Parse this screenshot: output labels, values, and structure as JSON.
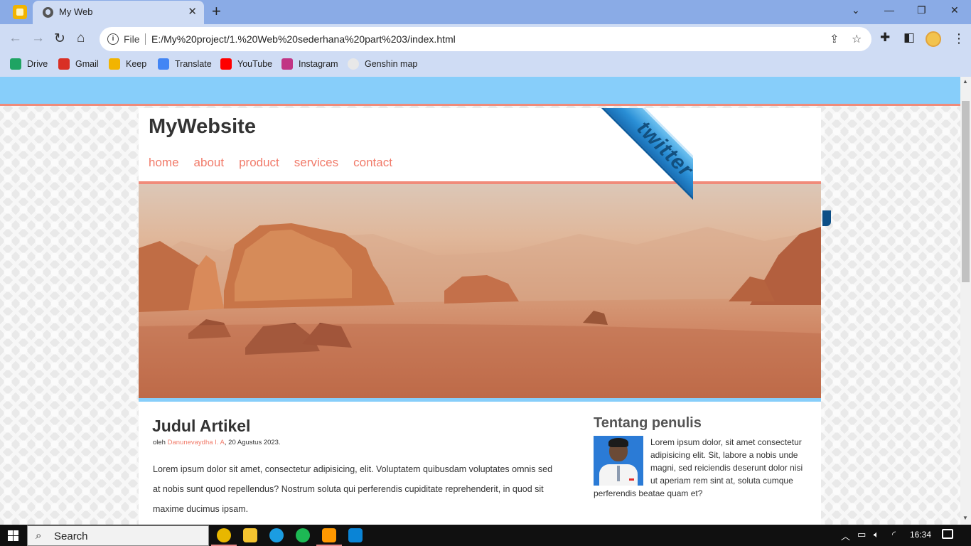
{
  "browser": {
    "tab_title": "My Web",
    "tab_close": "✕",
    "new_tab": "+",
    "window_controls": {
      "dropdown": "⌄",
      "minimize": "—",
      "restore": "❐",
      "close": "✕"
    },
    "file_label": "File",
    "url": "E:/My%20project/1.%20Web%20sederhana%20part%203/index.html",
    "bookmarks": [
      {
        "label": "Drive",
        "color": "#1fa463"
      },
      {
        "label": "Gmail",
        "color": "#d93025"
      },
      {
        "label": "Keep",
        "color": "#f2b400"
      },
      {
        "label": "Translate",
        "color": "#4285f4"
      },
      {
        "label": "YouTube",
        "color": "#ff0000"
      },
      {
        "label": "Instagram",
        "color": "#c13584"
      },
      {
        "label": "Genshin map",
        "color": "#e8e8e8"
      }
    ]
  },
  "site": {
    "title": "MyWebsite",
    "menu": [
      "home",
      "about",
      "product",
      "services",
      "contact"
    ],
    "ribbon_text": "twitter",
    "accent_color": "#f17b6a",
    "topbar_color": "#87cefa"
  },
  "article": {
    "title": "Judul Artikel",
    "meta_prefix": "oleh ",
    "author": "Danunevaydha I. A",
    "meta_suffix": ", 20 Agustus 2023.",
    "body": "Lorem ipsum dolor sit amet, consectetur adipisicing, elit. Voluptatem quibusdam voluptates omnis sed at nobis sunt quod repellendus? Nostrum soluta qui perferendis cupiditate reprehenderit, in quod sit maxime ducimus ipsam."
  },
  "aside": {
    "title": "Tentang penulis",
    "text": "Lorem ipsum dolor, sit amet consectetur adipisicing elit. Sit, labore a nobis unde magni, sed reiciendis deserunt dolor nisi ut aperiam rem sint at, soluta cumque perferendis beatae quam et?"
  },
  "taskbar": {
    "search_label": "Search",
    "time": "16:34",
    "apps": [
      {
        "name": "chrome",
        "color": "#e8b700",
        "active": true
      },
      {
        "name": "file-explorer",
        "color": "#f4c430",
        "active": false
      },
      {
        "name": "edge",
        "color": "#1b9de2",
        "active": false
      },
      {
        "name": "spotify",
        "color": "#1db954",
        "active": false
      },
      {
        "name": "sublime-text",
        "color": "#ff9800",
        "active": true
      },
      {
        "name": "vscode",
        "color": "#0a84d6",
        "active": false
      }
    ]
  }
}
